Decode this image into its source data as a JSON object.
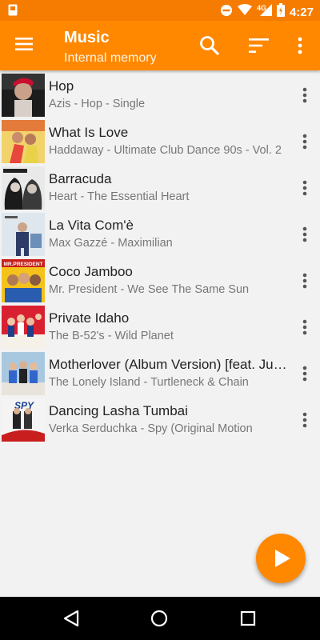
{
  "status_bar": {
    "time": "4:27",
    "network": "4G"
  },
  "app_bar": {
    "title": "Music",
    "subtitle": "Internal memory"
  },
  "songs": [
    {
      "title": "Hop",
      "subtitle": "Azis - Hop - Single"
    },
    {
      "title": "What Is Love",
      "subtitle": "Haddaway - Ultimate Club Dance 90s - Vol. 2"
    },
    {
      "title": "Barracuda",
      "subtitle": "Heart - The Essential Heart"
    },
    {
      "title": "La Vita Com'è",
      "subtitle": "Max Gazzé - Maximilian"
    },
    {
      "title": "Coco Jamboo",
      "subtitle": "Mr. President - We See The Same Sun"
    },
    {
      "title": "Private Idaho",
      "subtitle": "The B-52's - Wild Planet"
    },
    {
      "title": "Motherlover (Album Version) [feat. Justin Timberlake]",
      "subtitle": "The Lonely Island - Turtleneck & Chain"
    },
    {
      "title": "Dancing Lasha Tumbai",
      "subtitle": "Verka Serduchka - Spy (Original Motion"
    }
  ],
  "album_art_text": [
    "MR.PRESIDENT",
    "SPY"
  ],
  "colors": {
    "accent": "#ff8800",
    "status_bar": "#f57c00",
    "background": "#f2f2f2"
  },
  "icons": [
    "notification-icon",
    "do-not-disturb-icon",
    "wifi-icon",
    "signal-icon",
    "battery-icon",
    "menu-icon",
    "search-icon",
    "sort-icon",
    "more-vert-icon",
    "play-icon",
    "back-icon",
    "home-icon",
    "recent-apps-icon"
  ]
}
